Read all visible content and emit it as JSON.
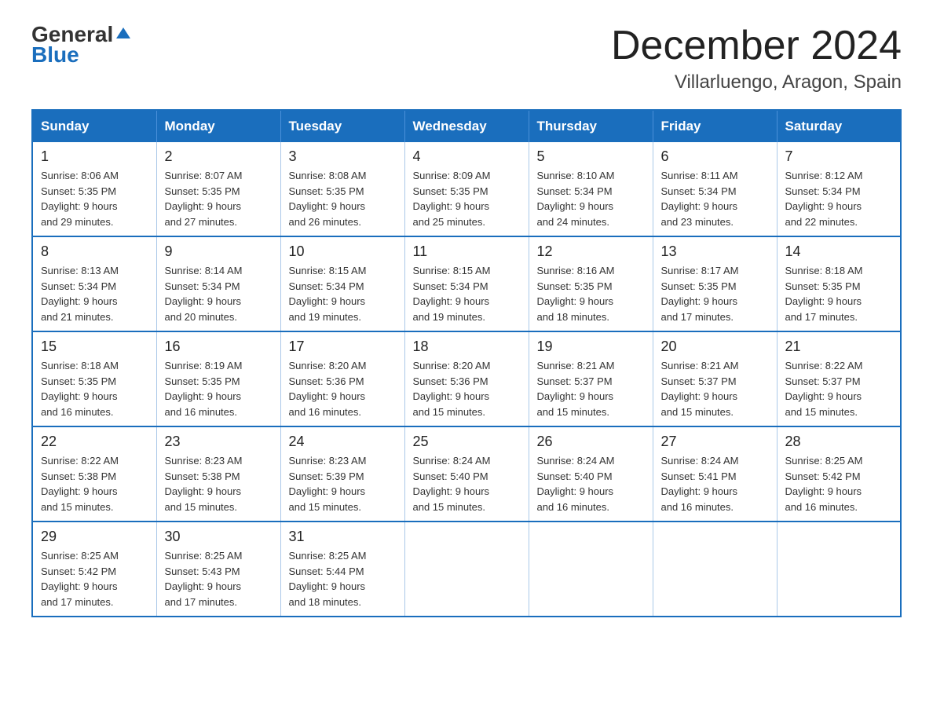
{
  "header": {
    "logo_general": "General",
    "logo_blue": "Blue",
    "title": "December 2024",
    "subtitle": "Villarluengo, Aragon, Spain"
  },
  "days_of_week": [
    "Sunday",
    "Monday",
    "Tuesday",
    "Wednesday",
    "Thursday",
    "Friday",
    "Saturday"
  ],
  "weeks": [
    [
      {
        "day": "1",
        "sunrise": "8:06 AM",
        "sunset": "5:35 PM",
        "daylight": "9 hours and 29 minutes."
      },
      {
        "day": "2",
        "sunrise": "8:07 AM",
        "sunset": "5:35 PM",
        "daylight": "9 hours and 27 minutes."
      },
      {
        "day": "3",
        "sunrise": "8:08 AM",
        "sunset": "5:35 PM",
        "daylight": "9 hours and 26 minutes."
      },
      {
        "day": "4",
        "sunrise": "8:09 AM",
        "sunset": "5:35 PM",
        "daylight": "9 hours and 25 minutes."
      },
      {
        "day": "5",
        "sunrise": "8:10 AM",
        "sunset": "5:34 PM",
        "daylight": "9 hours and 24 minutes."
      },
      {
        "day": "6",
        "sunrise": "8:11 AM",
        "sunset": "5:34 PM",
        "daylight": "9 hours and 23 minutes."
      },
      {
        "day": "7",
        "sunrise": "8:12 AM",
        "sunset": "5:34 PM",
        "daylight": "9 hours and 22 minutes."
      }
    ],
    [
      {
        "day": "8",
        "sunrise": "8:13 AM",
        "sunset": "5:34 PM",
        "daylight": "9 hours and 21 minutes."
      },
      {
        "day": "9",
        "sunrise": "8:14 AM",
        "sunset": "5:34 PM",
        "daylight": "9 hours and 20 minutes."
      },
      {
        "day": "10",
        "sunrise": "8:15 AM",
        "sunset": "5:34 PM",
        "daylight": "9 hours and 19 minutes."
      },
      {
        "day": "11",
        "sunrise": "8:15 AM",
        "sunset": "5:34 PM",
        "daylight": "9 hours and 19 minutes."
      },
      {
        "day": "12",
        "sunrise": "8:16 AM",
        "sunset": "5:35 PM",
        "daylight": "9 hours and 18 minutes."
      },
      {
        "day": "13",
        "sunrise": "8:17 AM",
        "sunset": "5:35 PM",
        "daylight": "9 hours and 17 minutes."
      },
      {
        "day": "14",
        "sunrise": "8:18 AM",
        "sunset": "5:35 PM",
        "daylight": "9 hours and 17 minutes."
      }
    ],
    [
      {
        "day": "15",
        "sunrise": "8:18 AM",
        "sunset": "5:35 PM",
        "daylight": "9 hours and 16 minutes."
      },
      {
        "day": "16",
        "sunrise": "8:19 AM",
        "sunset": "5:35 PM",
        "daylight": "9 hours and 16 minutes."
      },
      {
        "day": "17",
        "sunrise": "8:20 AM",
        "sunset": "5:36 PM",
        "daylight": "9 hours and 16 minutes."
      },
      {
        "day": "18",
        "sunrise": "8:20 AM",
        "sunset": "5:36 PM",
        "daylight": "9 hours and 15 minutes."
      },
      {
        "day": "19",
        "sunrise": "8:21 AM",
        "sunset": "5:37 PM",
        "daylight": "9 hours and 15 minutes."
      },
      {
        "day": "20",
        "sunrise": "8:21 AM",
        "sunset": "5:37 PM",
        "daylight": "9 hours and 15 minutes."
      },
      {
        "day": "21",
        "sunrise": "8:22 AM",
        "sunset": "5:37 PM",
        "daylight": "9 hours and 15 minutes."
      }
    ],
    [
      {
        "day": "22",
        "sunrise": "8:22 AM",
        "sunset": "5:38 PM",
        "daylight": "9 hours and 15 minutes."
      },
      {
        "day": "23",
        "sunrise": "8:23 AM",
        "sunset": "5:38 PM",
        "daylight": "9 hours and 15 minutes."
      },
      {
        "day": "24",
        "sunrise": "8:23 AM",
        "sunset": "5:39 PM",
        "daylight": "9 hours and 15 minutes."
      },
      {
        "day": "25",
        "sunrise": "8:24 AM",
        "sunset": "5:40 PM",
        "daylight": "9 hours and 15 minutes."
      },
      {
        "day": "26",
        "sunrise": "8:24 AM",
        "sunset": "5:40 PM",
        "daylight": "9 hours and 16 minutes."
      },
      {
        "day": "27",
        "sunrise": "8:24 AM",
        "sunset": "5:41 PM",
        "daylight": "9 hours and 16 minutes."
      },
      {
        "day": "28",
        "sunrise": "8:25 AM",
        "sunset": "5:42 PM",
        "daylight": "9 hours and 16 minutes."
      }
    ],
    [
      {
        "day": "29",
        "sunrise": "8:25 AM",
        "sunset": "5:42 PM",
        "daylight": "9 hours and 17 minutes."
      },
      {
        "day": "30",
        "sunrise": "8:25 AM",
        "sunset": "5:43 PM",
        "daylight": "9 hours and 17 minutes."
      },
      {
        "day": "31",
        "sunrise": "8:25 AM",
        "sunset": "5:44 PM",
        "daylight": "9 hours and 18 minutes."
      },
      null,
      null,
      null,
      null
    ]
  ],
  "labels": {
    "sunrise": "Sunrise:",
    "sunset": "Sunset:",
    "daylight": "Daylight:"
  }
}
